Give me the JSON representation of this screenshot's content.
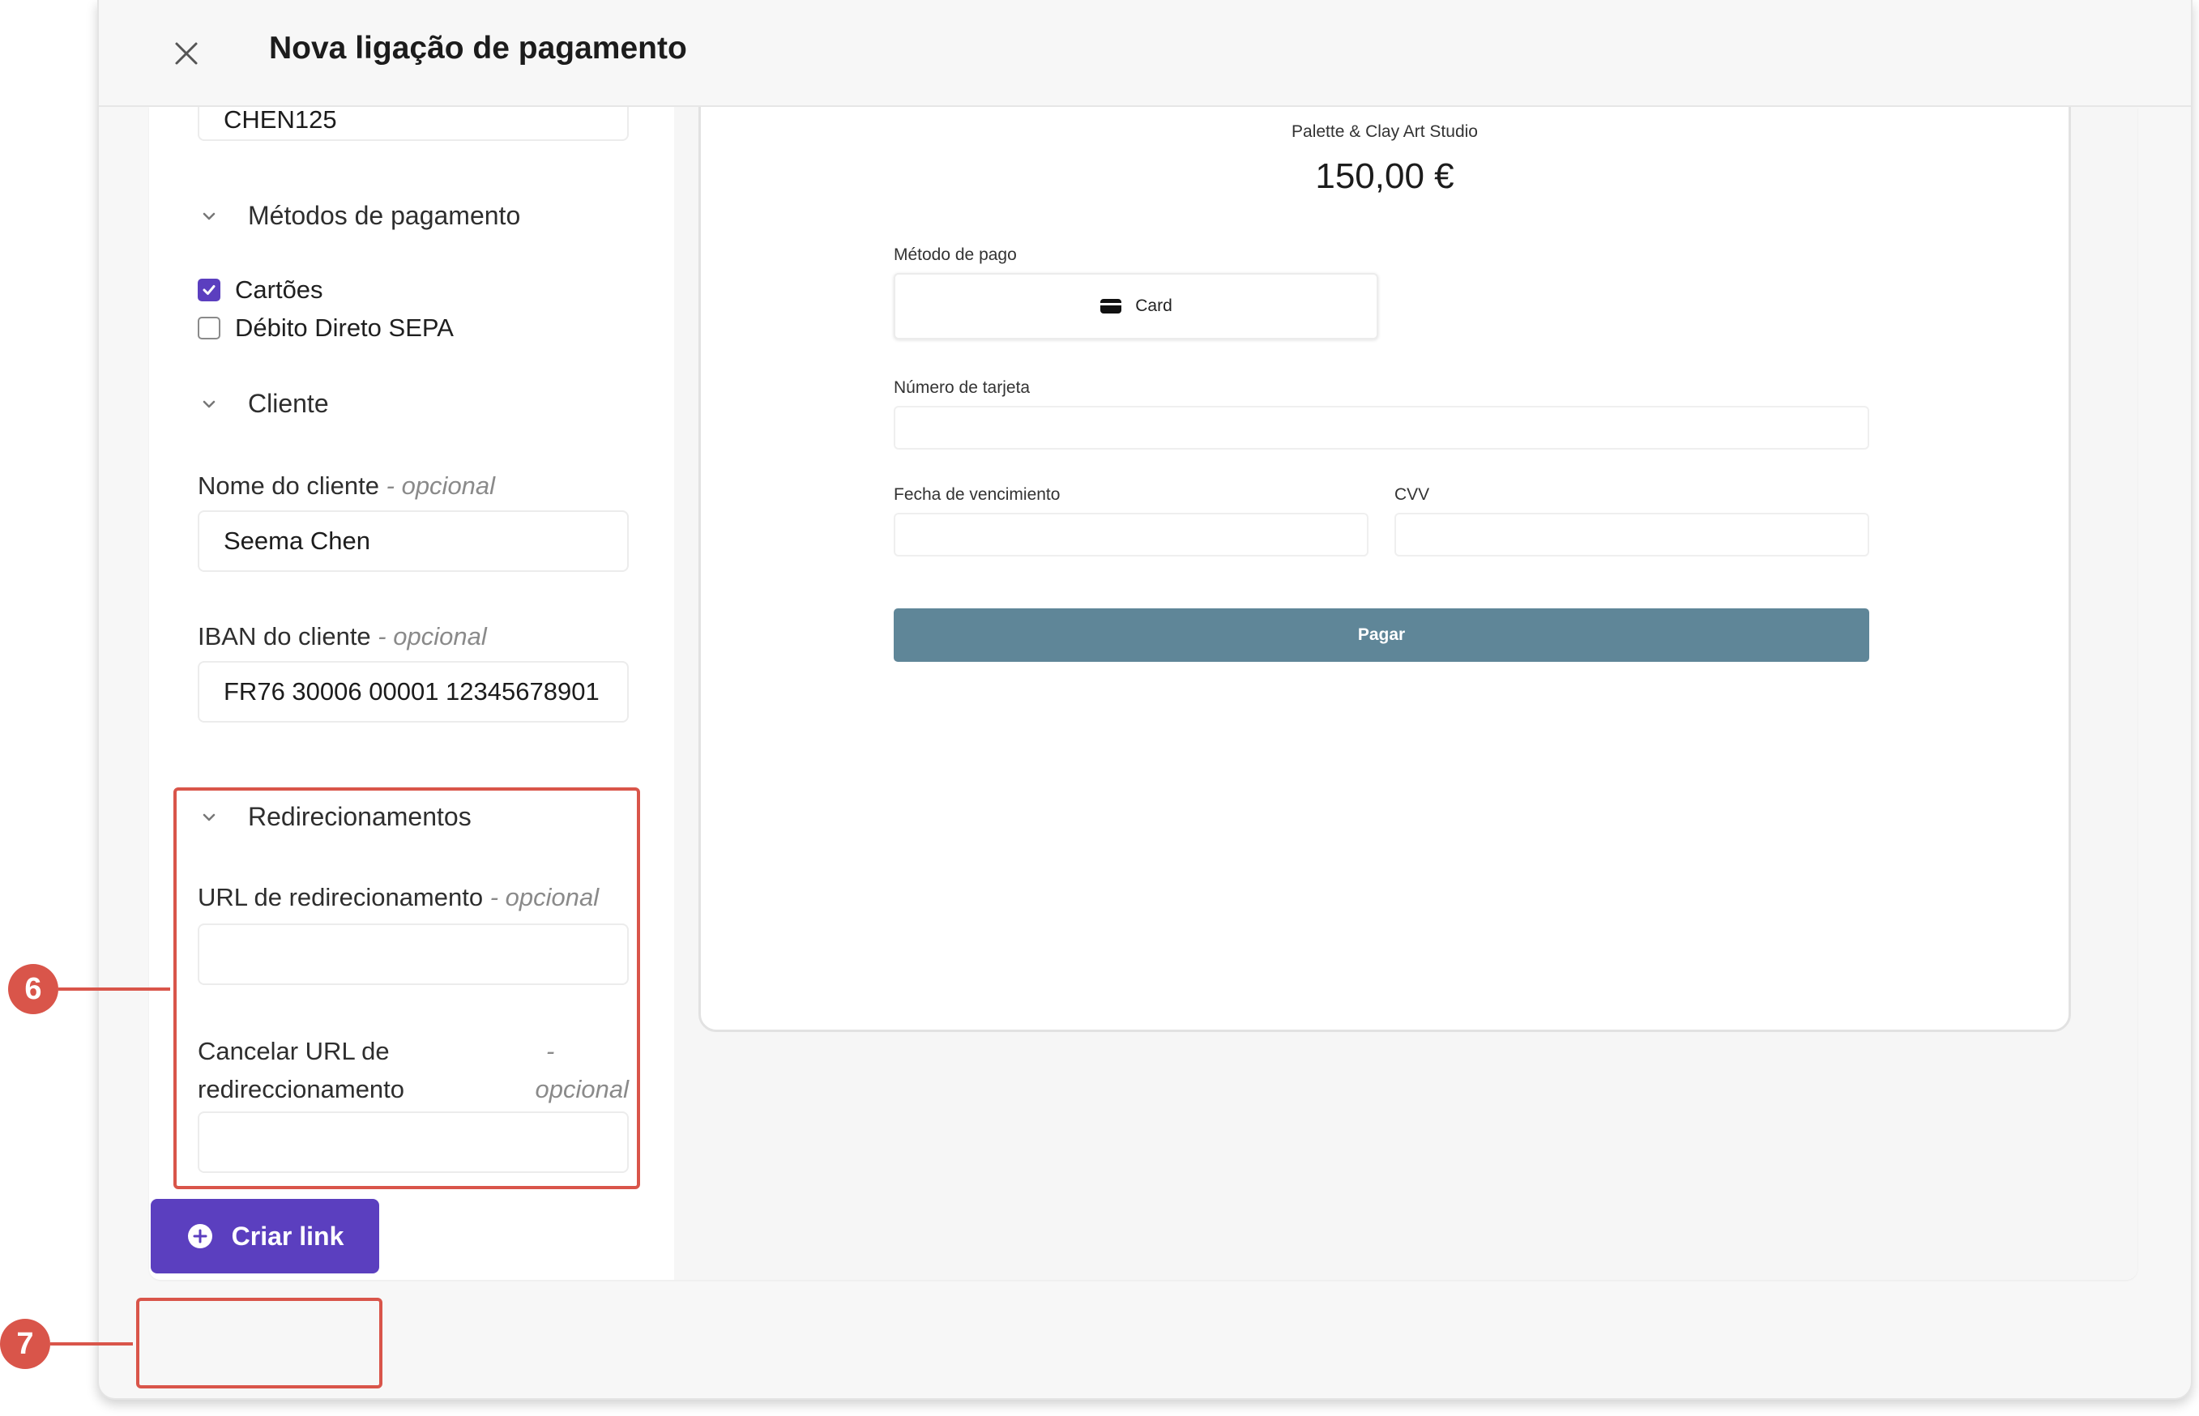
{
  "header": {
    "title": "Nova ligação de pagamento"
  },
  "form": {
    "coupon_value": "CHEN125",
    "payment_methods": {
      "title": "Métodos de pagamento",
      "options": [
        {
          "label": "Cartões",
          "checked": true
        },
        {
          "label": "Débito Direto SEPA",
          "checked": false
        }
      ]
    },
    "customer": {
      "title": "Cliente",
      "name_label": "Nome do cliente",
      "name_optional": "- opcional",
      "name_value": "Seema Chen",
      "iban_label": "IBAN do cliente",
      "iban_optional": "- opcional",
      "iban_value": "FR76 30006 00001 12345678901"
    },
    "redirects": {
      "title": "Redirecionamentos",
      "url_label": "URL de redirecionamento",
      "url_optional": "- opcional",
      "url_value": "",
      "cancel_label_line1": "Cancelar URL de",
      "cancel_label_line2": "redireccionamento",
      "cancel_optional_dash": "-",
      "cancel_optional_word": "opcional",
      "cancel_value": ""
    }
  },
  "preview": {
    "merchant": "Palette & Clay Art Studio",
    "amount": "150,00 €",
    "method_label": "Método de pago",
    "method_option": "Card",
    "card_number_label": "Número de tarjeta",
    "expiry_label": "Fecha de vencimiento",
    "cvv_label": "CVV",
    "pay_button": "Pagar"
  },
  "footer": {
    "create_button": "Criar link"
  },
  "annotations": {
    "badge_6": "6",
    "badge_7": "7"
  },
  "colors": {
    "accent": "#5b3fbf",
    "annotation": "#d9554a",
    "pay_button": "#5f8698"
  }
}
